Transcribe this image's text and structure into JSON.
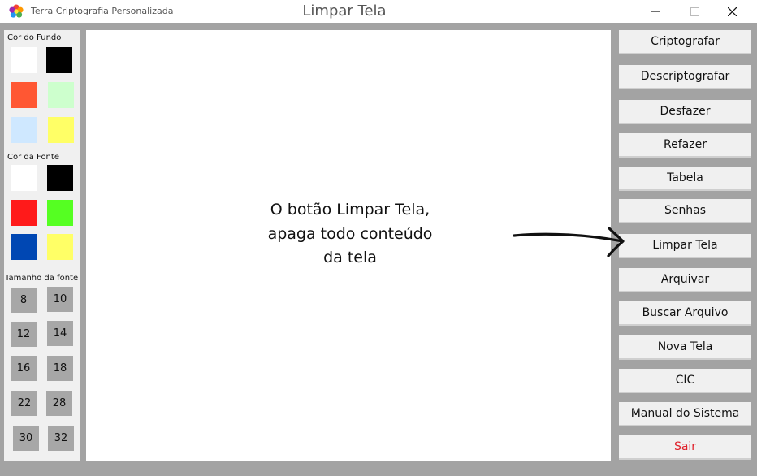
{
  "window": {
    "app_title": "Terra Criptografia Personalizada",
    "title": "Limpar Tela",
    "controls": {
      "minimize": "—",
      "maximize": "☐",
      "close": "✕"
    }
  },
  "left_panel": {
    "background_label": "Cor do Fundo",
    "background_colors": [
      "#ffffff",
      "#000000",
      "#ff5733",
      "#cdffcd",
      "#cfe8ff",
      "#ffff66"
    ],
    "font_color_label": "Cor da Fonte",
    "font_colors": [
      "#ffffff",
      "#000000",
      "#ff1a1a",
      "#55ff22",
      "#0047b3",
      "#ffff66"
    ],
    "font_size_label": "Tamanho da fonte",
    "font_sizes": [
      "8",
      "10",
      "12",
      "14",
      "16",
      "18",
      "22",
      "28",
      "30",
      "32"
    ]
  },
  "canvas": {
    "note_line1": "O botão Limpar Tela,",
    "note_line2": "apaga todo conteúdo",
    "note_line3": "da tela"
  },
  "right_panel": {
    "buttons": [
      "Criptografar",
      "Descriptografar",
      "Desfazer",
      "Refazer",
      "Tabela",
      "Senhas",
      "Limpar Tela",
      "Arquivar",
      "Buscar Arquivo",
      "Nova Tela",
      "CIC",
      "Manual do Sistema",
      "Sair"
    ]
  },
  "colors": {
    "exit_text": "#e0202a",
    "window_bg": "#a3a3a3"
  },
  "icons": {
    "app": "colorful-gear-icon",
    "annotation": "arrow-right-icon"
  }
}
